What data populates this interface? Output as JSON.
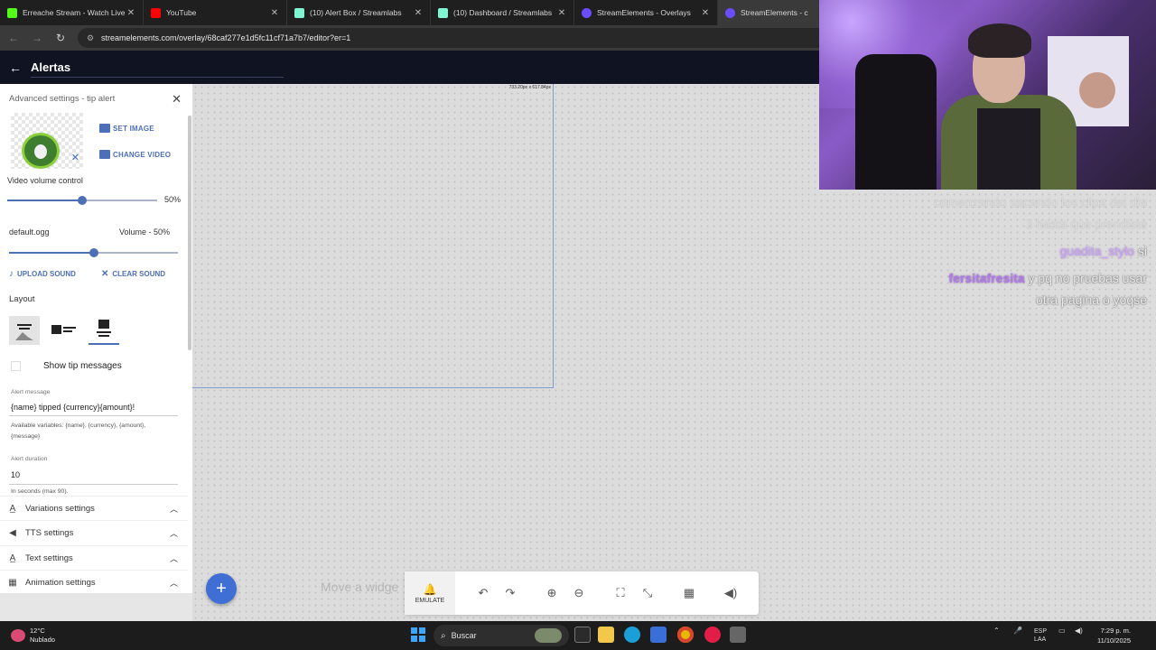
{
  "browser": {
    "tabs": [
      {
        "label": "Erreache Stream - Watch Live o",
        "icon_color": "#53fc18"
      },
      {
        "label": "YouTube",
        "icon_color": "#ff0000"
      },
      {
        "label": "(10) Alert Box / Streamlabs",
        "icon_color": "#80f5d2"
      },
      {
        "label": "(10) Dashboard / Streamlabs",
        "icon_color": "#80f5d2"
      },
      {
        "label": "StreamElements - Overlays",
        "icon_color": "#6b4cff"
      },
      {
        "label": "StreamElements - c",
        "icon_color": "#6b4cff"
      }
    ],
    "url": "streamelements.com/overlay/68caf277e1d5fc11cf71a7b7/editor?er=1"
  },
  "header": {
    "title": "Alertas"
  },
  "panel": {
    "heading": "Advanced settings - tip alert",
    "set_image": "SET IMAGE",
    "change_video": "CHANGE VIDEO",
    "video_volume_label": "Video volume control",
    "video_volume_value": "50%",
    "video_volume_fraction": 0.5,
    "sound_file": "default.ogg",
    "sound_volume_label": "Volume - 50%",
    "sound_volume_fraction": 0.5,
    "upload_sound": "UPLOAD SOUND",
    "clear_sound": "CLEAR SOUND",
    "layout_label": "Layout",
    "show_tip_messages": "Show tip messages",
    "alert_message_label": "Alert message",
    "alert_message_value": "{name} tipped {currency}{amount}!",
    "available_variables": "Available variables: {name}, {currency}, {amount}, {message}",
    "alert_duration_label": "Alert duration",
    "alert_duration_value": "10",
    "alert_duration_hint": "In seconds (max 90).",
    "accordions": [
      {
        "label": "Variations settings",
        "icon": "text-icon"
      },
      {
        "label": "TTS settings",
        "icon": "speaker-icon"
      },
      {
        "label": "Text settings",
        "icon": "text-icon"
      },
      {
        "label": "Animation settings",
        "icon": "animation-icon"
      }
    ]
  },
  "canvas": {
    "widget_size": "733.20px x 617.84px",
    "move_hint": "Move a widge"
  },
  "toolbar": {
    "emulate": "EMULATE"
  },
  "chat": {
    "lines": [
      {
        "text": "comenzando sacando los clips del dia",
        "kind": "faint"
      },
      {
        "text": "3 hasta que prendiste",
        "kind": "faint"
      },
      {
        "user": "guadita_stylo",
        "text": "si"
      },
      {
        "user": "fersitafresita",
        "text": "y pq no pruebas usar"
      },
      {
        "text": "otra pagina o yoqse",
        "kind": "msg"
      }
    ]
  },
  "taskbar": {
    "weather_temp": "12°C",
    "weather_desc": "Nublado",
    "search": "Buscar",
    "lang": "ESP",
    "lang_region": "LAA",
    "time": "7:29 p. m.",
    "date": "11/10/2025"
  }
}
